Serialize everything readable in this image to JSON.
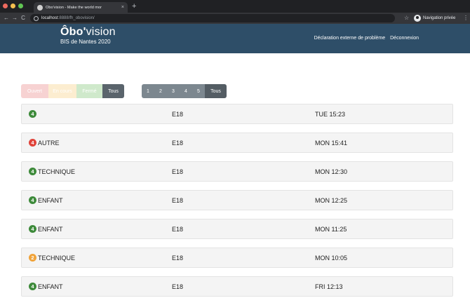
{
  "browser": {
    "tab_title": "Ôbo'vision - Make the world mor",
    "tab_close": "×",
    "new_tab": "+",
    "url_host": "localhost",
    "url_path": ":8888/fh_obovision/",
    "private_label": "Navigation privée",
    "back": "←",
    "forward": "→",
    "reload": "C",
    "star": "☆",
    "menu": "⋮"
  },
  "header": {
    "logo_bold": "Ôbo'",
    "logo_light": "vision",
    "logo_sub": "BIS de Nantes 2020",
    "links": [
      "Déclaration externe de problème",
      "Déconnexion"
    ]
  },
  "filters": {
    "status": [
      "Ouvert",
      "En cours",
      "Fermé",
      "Tous"
    ],
    "pages": [
      "1",
      "2",
      "3",
      "4",
      "5",
      "Tous"
    ]
  },
  "colors": {
    "green": "#3d8a3a",
    "red": "#e0433a",
    "orange": "#f0a33a"
  },
  "rows": [
    {
      "badge": "4",
      "badge_color": "#3d8a3a",
      "category": "",
      "room": "E18",
      "time": "TUE 15:23"
    },
    {
      "badge": "4",
      "badge_color": "#e0433a",
      "category": "AUTRE",
      "room": "E18",
      "time": "MON 15:41"
    },
    {
      "badge": "4",
      "badge_color": "#3d8a3a",
      "category": "TECHNIQUE",
      "room": "E18",
      "time": "MON 12:30"
    },
    {
      "badge": "4",
      "badge_color": "#3d8a3a",
      "category": "ENFANT",
      "room": "E18",
      "time": "MON 12:25"
    },
    {
      "badge": "4",
      "badge_color": "#3d8a3a",
      "category": "ENFANT",
      "room": "E18",
      "time": "MON 11:25"
    },
    {
      "badge": "2",
      "badge_color": "#f0a33a",
      "category": "TECHNIQUE",
      "room": "E18",
      "time": "MON 10:05"
    },
    {
      "badge": "4",
      "badge_color": "#3d8a3a",
      "category": "ENFANT",
      "room": "E18",
      "time": "FRI 12:13"
    }
  ]
}
